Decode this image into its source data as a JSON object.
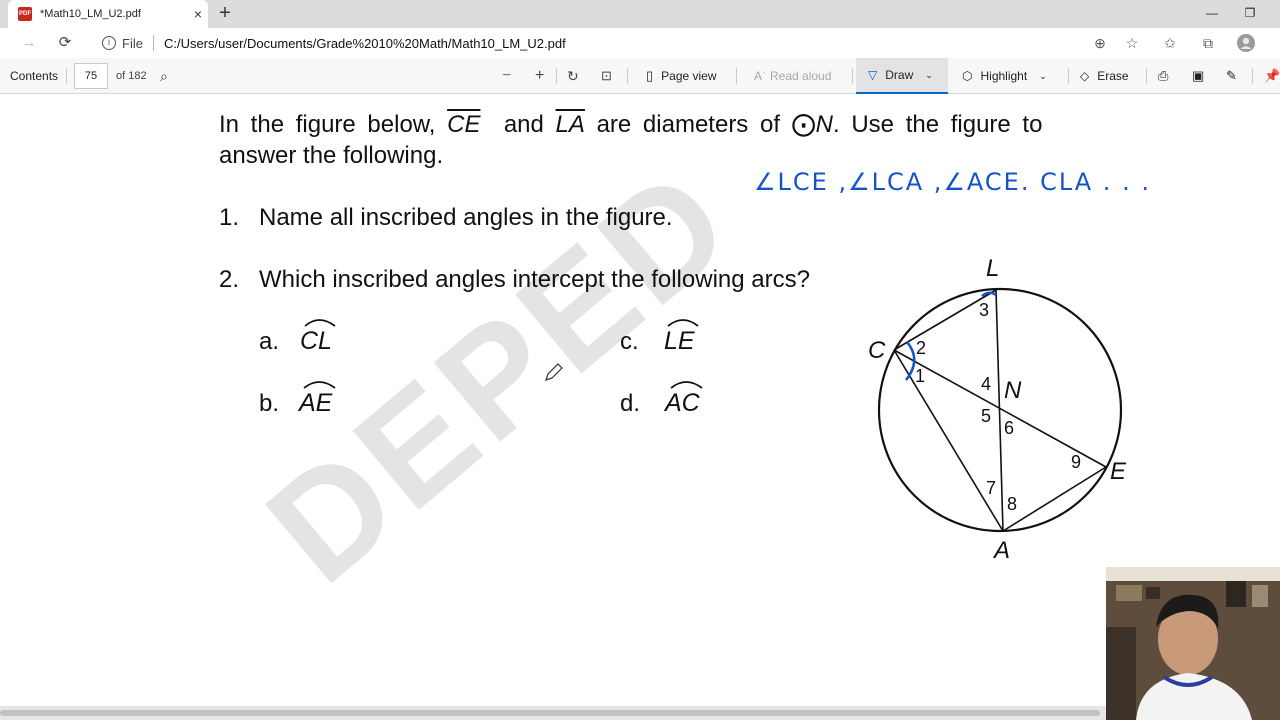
{
  "tab": {
    "title": "*Math10_LM_U2.pdf",
    "close": "×",
    "new": "+",
    "icon_text": "PDF"
  },
  "window": {
    "minimize": "—",
    "restore": "❐"
  },
  "address": {
    "file_label": "File",
    "url": "C:/Users/user/Documents/Grade%2010%20Math/Math10_LM_U2.pdf"
  },
  "pdf_toolbar": {
    "contents": "Contents",
    "page_number": "75",
    "page_total": "of 182",
    "page_view": "Page view",
    "read_aloud": "Read aloud",
    "draw": "Draw",
    "highlight": "Highlight",
    "erase": "Erase"
  },
  "document": {
    "watermark": "DEPED",
    "intro_1": "In the figure below,",
    "seg_ce": "CE",
    "and": "and",
    "seg_la": "LA",
    "are_diam": "are diameters of",
    "circle_sym": "⨀",
    "circle_n": "N",
    "intro_2": ". Use the figure to",
    "intro_3": "answer the following.",
    "q1_num": "1.",
    "q1": "Name all inscribed angles in the figure.",
    "q2_num": "2.",
    "q2": "Which inscribed angles intercept the following arcs?",
    "items": [
      {
        "letter": "a.",
        "arc": "CL"
      },
      {
        "letter": "b.",
        "arc": "AE"
      },
      {
        "letter": "c.",
        "arc": "LE"
      },
      {
        "letter": "d.",
        "arc": "AC"
      }
    ],
    "handwritten": "∠LCE ,∠LCA ,∠ACE. CLA . . .",
    "figure": {
      "points": {
        "L": "L",
        "C": "C",
        "N": "N",
        "E": "E",
        "A": "A"
      },
      "angles": [
        "1",
        "2",
        "3",
        "4",
        "5",
        "6",
        "7",
        "8",
        "9"
      ]
    }
  },
  "colors": {
    "ink": "#1454c9",
    "accent": "#0a64c8",
    "pdf_red": "#c42b1c"
  }
}
